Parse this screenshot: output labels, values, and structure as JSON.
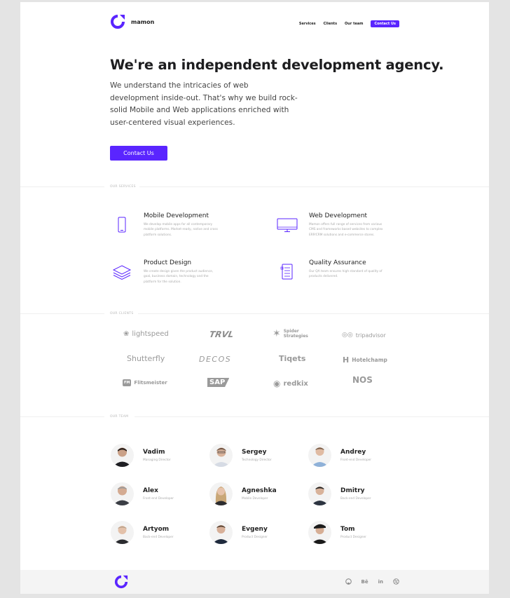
{
  "brand": {
    "name": "mamon",
    "accent": "#5a25ff"
  },
  "nav": {
    "items": [
      "Services",
      "Clients",
      "Our team"
    ],
    "cta": "Contact Us"
  },
  "hero": {
    "title": "We're an independent development agency.",
    "description": "We understand the intricacies of web development inside-out. That's why we build rock-solid Mobile and Web applications enriched with user-centered visual experiences.",
    "button": "Contact Us"
  },
  "services": {
    "label": "OUR SERVICES",
    "items": [
      {
        "title": "Mobile Development",
        "desc": "We develop mobile apps for all contemporary mobile platforms. Market-ready, native and cross platform solutions.",
        "icon": "smartphone-icon"
      },
      {
        "title": "Web Development",
        "desc": "Mamon offers full range of services from various CMS and frameworks based websites to complex ERP/CRM solutions and e-commerce stores.",
        "icon": "monitor-icon"
      },
      {
        "title": "Product Design",
        "desc": "We create design given the product audience, goal, business domain, technology and the platform for the solution.",
        "icon": "layers-icon"
      },
      {
        "title": "Quality Assurance",
        "desc": "Our QA team ensures high standard of quality of products delivered.",
        "icon": "checklist-icon"
      }
    ]
  },
  "clients": {
    "label": "OUR CLIENTS",
    "items": [
      "lightspeed",
      "TRVL",
      "Spider Strategies",
      "tripadvisor",
      "Shutterfly",
      "DECOS",
      "Tiqets",
      "Hotelchamp",
      "Flitsmeister",
      "SAP",
      "redkix",
      "NOS"
    ]
  },
  "team": {
    "label": "OUR TEAM",
    "members": [
      {
        "name": "Vadim",
        "role": "Managing Director"
      },
      {
        "name": "Sergey",
        "role": "Technology Director"
      },
      {
        "name": "Andrey",
        "role": "Front-end Developer"
      },
      {
        "name": "Alex",
        "role": "Front-end Developer"
      },
      {
        "name": "Agneshka",
        "role": "Mobile Developer"
      },
      {
        "name": "Dmitry",
        "role": "Back-end Developer"
      },
      {
        "name": "Artyom",
        "role": "Back-end Developer"
      },
      {
        "name": "Evgeny",
        "role": "Product Designer"
      },
      {
        "name": "Tom",
        "role": "Product Designer"
      }
    ]
  },
  "footer": {
    "social": [
      "github-icon",
      "Bē",
      "in",
      "dribbble-icon"
    ]
  }
}
